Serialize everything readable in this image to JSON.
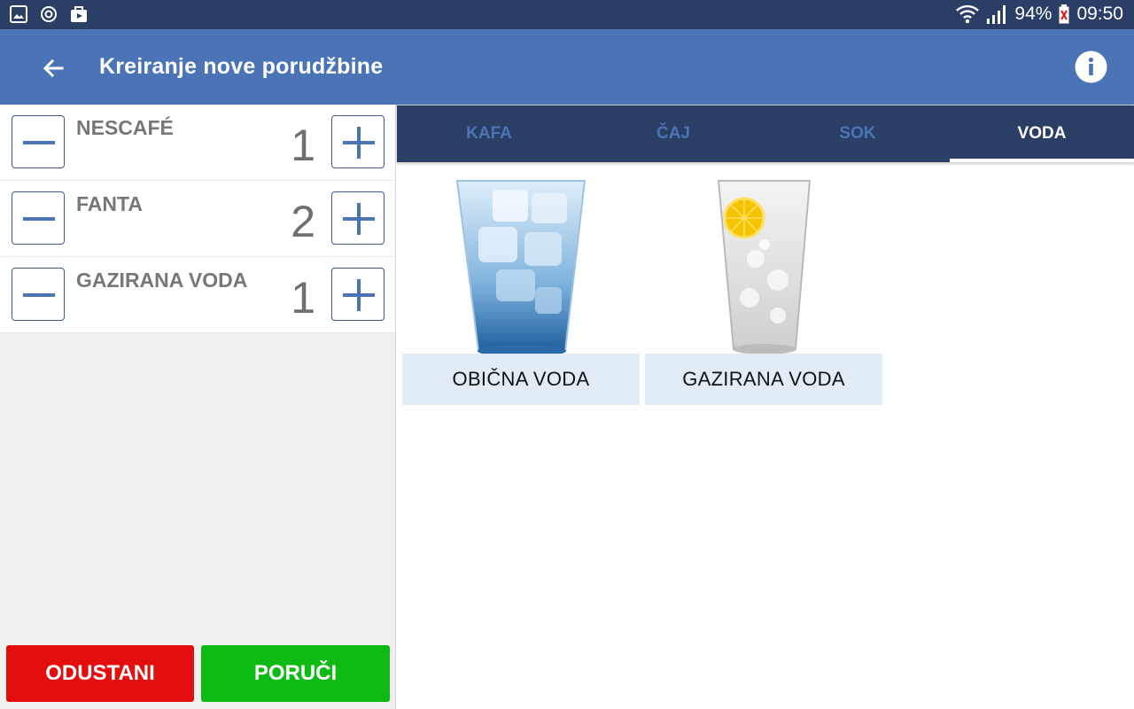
{
  "status_bar": {
    "battery": "94%",
    "time": "09:50",
    "icons": [
      "gallery-icon",
      "sync-icon",
      "shopping-bag-icon",
      "wifi-icon",
      "signal-icon",
      "battery-icon"
    ]
  },
  "app_bar": {
    "title": "Kreiranje nove porudžbine",
    "back_icon": "arrow-left-icon",
    "info_icon": "info-icon"
  },
  "order": {
    "items": [
      {
        "name": "NESCAFÉ",
        "quantity": "1"
      },
      {
        "name": "FANTA",
        "quantity": "2"
      },
      {
        "name": "GAZIRANA VODA",
        "quantity": "1"
      }
    ],
    "cancel_label": "ODUSTANI",
    "order_label": "PORUČI"
  },
  "tabs": [
    {
      "label": "KAFA",
      "active": false
    },
    {
      "label": "ČAJ",
      "active": false
    },
    {
      "label": "SOK",
      "active": false
    },
    {
      "label": "VODA",
      "active": true
    }
  ],
  "products": [
    {
      "label": "OBIČNA VODA",
      "image": "glass-water-ice-image"
    },
    {
      "label": "GAZIRANA VODA",
      "image": "glass-sparkling-water-lemon-image"
    }
  ],
  "colors": {
    "status_bar": "#2b3f66",
    "app_bar": "#4a74b5",
    "tab_bar": "#2b3f66",
    "tab_inactive_text": "#4a74b5",
    "cancel": "#e30e0e",
    "order": "#0ebb14",
    "product_label_bg": "#e2ecf7"
  }
}
